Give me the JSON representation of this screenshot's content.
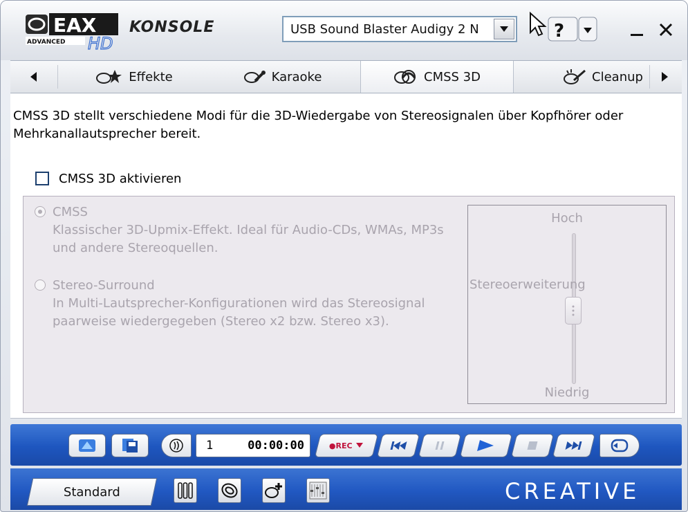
{
  "app": {
    "logo_text": "EAX",
    "logo_sub": "ADVANCED HD",
    "title": "KONSOLE",
    "device_selected": "USB Sound Blaster Audigy 2 N",
    "help_label": "?"
  },
  "tabs": {
    "items": [
      {
        "label": "Effekte",
        "active": false
      },
      {
        "label": "Karaoke",
        "active": false
      },
      {
        "label": "CMSS 3D",
        "active": true
      },
      {
        "label": "Cleanup",
        "active": false
      }
    ]
  },
  "content": {
    "description": "CMSS 3D stellt verschiedene Modi für die 3D-Wiedergabe von Stereosignalen über Kopfhörer oder Mehrkanallautsprecher bereit.",
    "enable_label": "CMSS 3D aktivieren",
    "enable_checked": false,
    "options": [
      {
        "label": "CMSS",
        "selected": true,
        "description": "Klassischer 3D-Upmix-Effekt. Ideal für Audio-CDs, WMAs, MP3s und andere Stereoquellen."
      },
      {
        "label": "Stereo-Surround",
        "selected": false,
        "description": "In Multi-Lautsprecher-Konfigurationen wird das Stereosignal paarweise wiedergegeben (Stereo x2 bzw. Stereo x3)."
      }
    ],
    "slider": {
      "high_label": "Hoch",
      "low_label": "Niedrig",
      "name_label": "Stereoerweiterung",
      "level": 0.5
    }
  },
  "transport": {
    "track_number": "1",
    "time": "00:00:00",
    "rec_label": "●REC"
  },
  "bottom": {
    "preset_label": "Standard",
    "brand": "CREATIVE"
  },
  "colors": {
    "transport_blue": "#1e56bf",
    "disabled_text": "#a9a4ad",
    "panel_bg": "#ece9ee"
  }
}
